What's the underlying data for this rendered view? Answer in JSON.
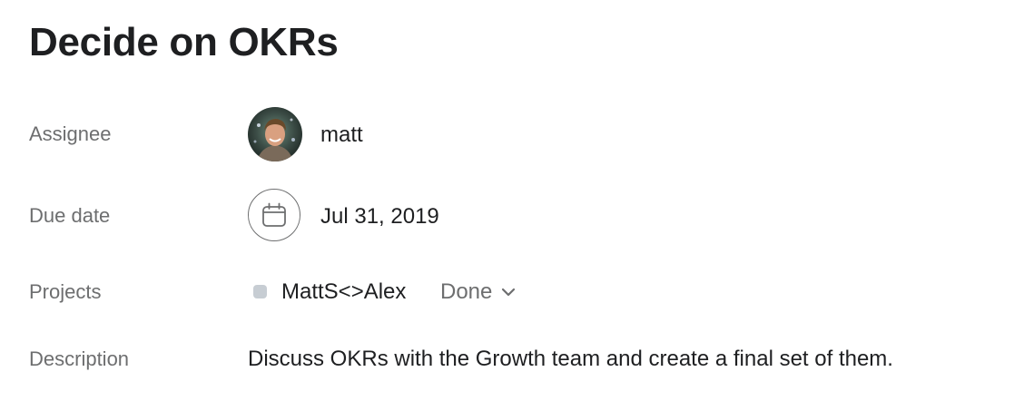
{
  "task": {
    "title": "Decide on OKRs"
  },
  "fields": {
    "assignee": {
      "label": "Assignee",
      "name": "matt"
    },
    "due_date": {
      "label": "Due date",
      "value": "Jul 31, 2019",
      "icon": "calendar-icon"
    },
    "projects": {
      "label": "Projects",
      "project_name": "MattS<>Alex",
      "project_color": "#c7cdd3",
      "section": "Done",
      "icon": "chevron-down-icon"
    },
    "description": {
      "label": "Description",
      "text": "Discuss OKRs with the Growth team and create a final set of them."
    }
  }
}
